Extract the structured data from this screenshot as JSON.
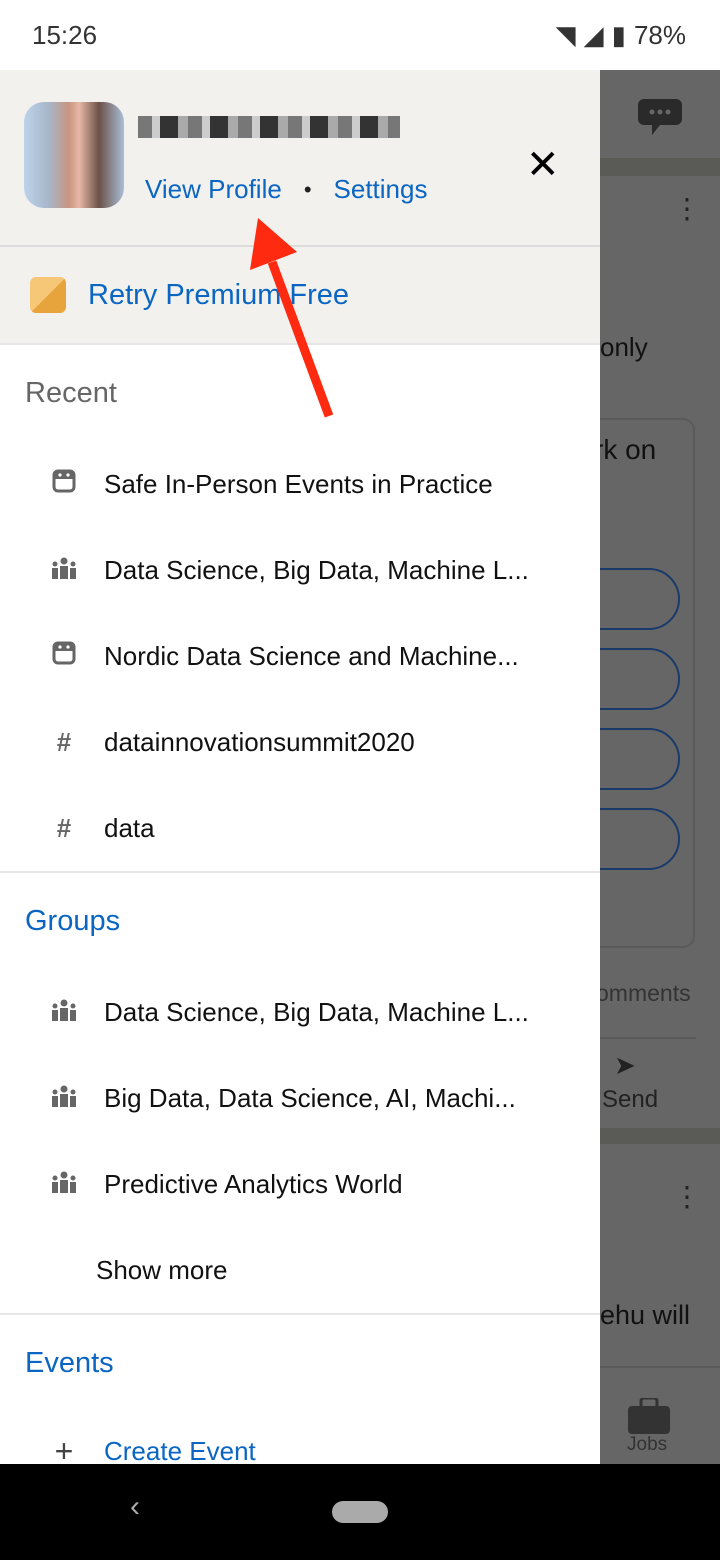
{
  "status": {
    "time": "15:26",
    "battery": "78%"
  },
  "background": {
    "only": "only",
    "rk_on": "rk on",
    "comments": "omments",
    "send": "Send",
    "ehu_will": "ehu will",
    "jobs": "Jobs"
  },
  "drawer": {
    "view_profile": "View Profile",
    "separator": "•",
    "settings": "Settings",
    "premium": "Retry Premium Free",
    "recent_title": "Recent",
    "recent": [
      {
        "icon": "event-icon",
        "label": "Safe In-Person Events in Practice"
      },
      {
        "icon": "group-icon",
        "label": "Data Science, Big Data, Machine L..."
      },
      {
        "icon": "event-icon",
        "label": "Nordic Data Science and Machine..."
      },
      {
        "icon": "hashtag-icon",
        "label": "datainnovationsummit2020"
      },
      {
        "icon": "hashtag-icon",
        "label": "data"
      }
    ],
    "groups_title": "Groups",
    "groups": [
      {
        "icon": "group-icon",
        "label": "Data Science, Big Data, Machine L..."
      },
      {
        "icon": "group-icon",
        "label": "Big Data, Data Science, AI, Machi..."
      },
      {
        "icon": "group-icon",
        "label": "Predictive Analytics World"
      }
    ],
    "show_more": "Show more",
    "events_title": "Events",
    "create_event": "Create Event"
  },
  "colors": {
    "link": "#0a66c2",
    "arrow": "#ff2a0f"
  }
}
